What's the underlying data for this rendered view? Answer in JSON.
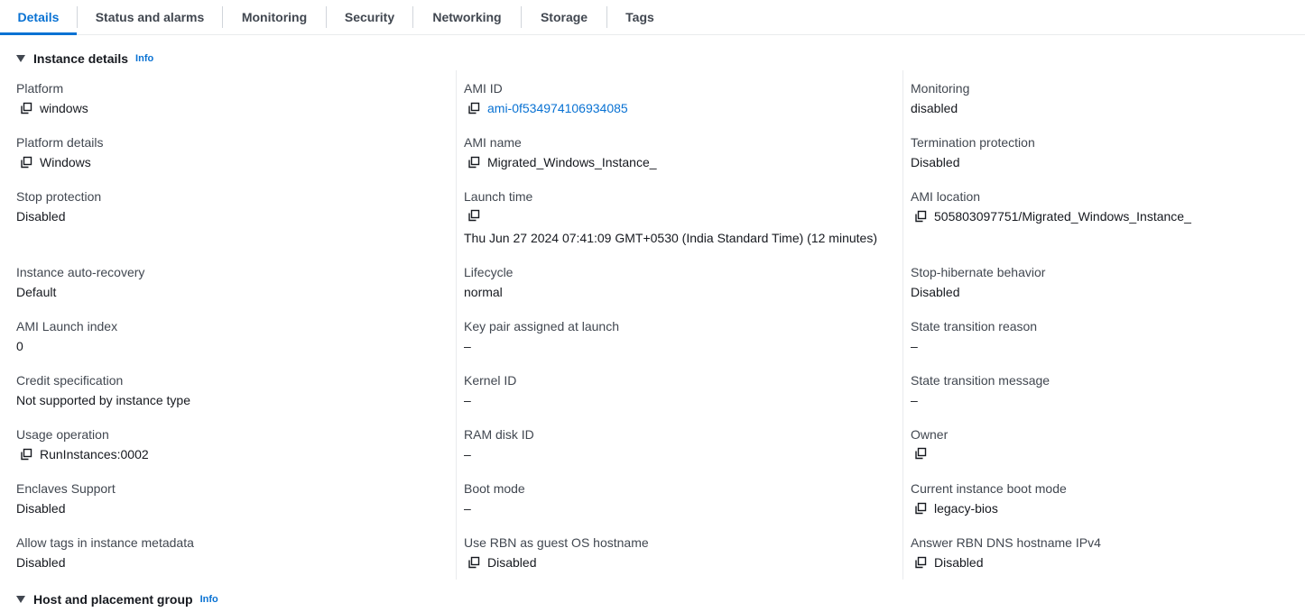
{
  "tabs": [
    {
      "label": "Details",
      "active": true
    },
    {
      "label": "Status and alarms",
      "active": false
    },
    {
      "label": "Monitoring",
      "active": false
    },
    {
      "label": "Security",
      "active": false
    },
    {
      "label": "Networking",
      "active": false
    },
    {
      "label": "Storage",
      "active": false
    },
    {
      "label": "Tags",
      "active": false
    }
  ],
  "instance_details": {
    "title": "Instance details",
    "info": "Info"
  },
  "host_placement": {
    "title": "Host and placement group",
    "info": "Info"
  },
  "columns": [
    [
      {
        "label": "Platform",
        "value": "windows",
        "copy": true
      },
      {
        "label": "Platform details",
        "value": "Windows",
        "copy": true
      },
      {
        "label": "Stop protection",
        "value": "Disabled"
      },
      {
        "label": "Instance auto-recovery",
        "value": "Default"
      },
      {
        "label": "AMI Launch index",
        "value": "0"
      },
      {
        "label": "Credit specification",
        "value": "Not supported by instance type"
      },
      {
        "label": "Usage operation",
        "value": "RunInstances:0002",
        "copy": true
      },
      {
        "label": "Enclaves Support",
        "value": "Disabled"
      },
      {
        "label": "Allow tags in instance metadata",
        "value": "Disabled"
      }
    ],
    [
      {
        "label": "AMI ID",
        "value": "ami-0f534974106934085",
        "copy": true,
        "link": true
      },
      {
        "label": "AMI name",
        "value": "Migrated_Windows_Instance_",
        "copy": true
      },
      {
        "label": "Launch time",
        "value": "Thu Jun 27 2024 07:41:09 GMT+0530 (India Standard Time) (12 minutes)",
        "copy": true
      },
      {
        "label": "Lifecycle",
        "value": "normal"
      },
      {
        "label": "Key pair assigned at launch",
        "value": "–"
      },
      {
        "label": "Kernel ID",
        "value": "–"
      },
      {
        "label": "RAM disk ID",
        "value": "–"
      },
      {
        "label": "Boot mode",
        "value": "–"
      },
      {
        "label": "Use RBN as guest OS hostname",
        "value": "Disabled",
        "copy": true
      }
    ],
    [
      {
        "label": "Monitoring",
        "value": "disabled"
      },
      {
        "label": "Termination protection",
        "value": "Disabled"
      },
      {
        "label": "AMI location",
        "value": "505803097751/Migrated_Windows_Instance_",
        "copy": true
      },
      {
        "label": "Stop-hibernate behavior",
        "value": "Disabled"
      },
      {
        "label": "State transition reason",
        "value": "–"
      },
      {
        "label": "State transition message",
        "value": "–"
      },
      {
        "label": "Owner",
        "value": "",
        "copy": true
      },
      {
        "label": "Current instance boot mode",
        "value": "legacy-bios",
        "copy": true
      },
      {
        "label": "Answer RBN DNS hostname IPv4",
        "value": "Disabled",
        "copy": true
      }
    ]
  ],
  "icons": {
    "copy": "copy-icon",
    "caret": "caret-down-icon"
  },
  "colors": {
    "accent": "#0972d3",
    "text": "#16191f",
    "label": "#414750",
    "divider": "#e9ebed"
  }
}
